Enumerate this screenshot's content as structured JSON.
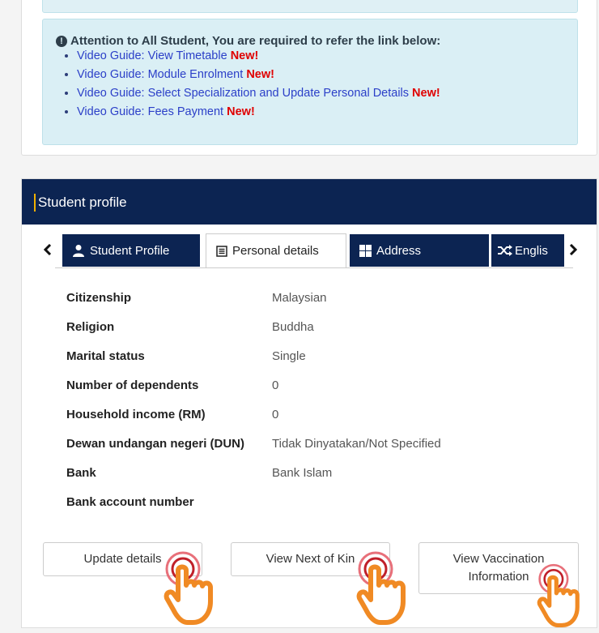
{
  "alert": {
    "heading": "Attention to All Student, You are required to refer the link below:",
    "items": [
      {
        "text": "Video Guide: View Timetable",
        "badge": "New!"
      },
      {
        "text": "Video Guide: Module Enrolment",
        "badge": "New!"
      },
      {
        "text": "Video Guide: Select Specialization and Update Personal Details",
        "badge": "New!"
      },
      {
        "text": "Video Guide: Fees Payment",
        "badge": "New!"
      }
    ]
  },
  "profile": {
    "title": "Student profile",
    "tabs": [
      {
        "label": "Student Profile",
        "icon": "user-icon"
      },
      {
        "label": "Personal details",
        "icon": "list-icon"
      },
      {
        "label": "Address",
        "icon": "grid-icon"
      },
      {
        "label": "Englis",
        "icon": "shuffle-icon"
      }
    ],
    "details": [
      {
        "label": "Citizenship",
        "value": "Malaysian"
      },
      {
        "label": "Religion",
        "value": "Buddha"
      },
      {
        "label": "Marital status",
        "value": "Single"
      },
      {
        "label": "Number of dependents",
        "value": "0"
      },
      {
        "label": "Household income (RM)",
        "value": "0"
      },
      {
        "label": "Dewan undangan negeri (DUN)",
        "value": "Tidak Dinyatakan/Not Specified"
      },
      {
        "label": "Bank",
        "value": "Bank Islam"
      },
      {
        "label": "Bank account number",
        "value": ""
      }
    ],
    "buttons": {
      "update": "Update details",
      "next_of_kin": "View Next of Kin",
      "vaccination_line1": "View Vaccination",
      "vaccination_line2": "Information"
    }
  },
  "colors": {
    "header_bg": "#0c2452",
    "accent_bar": "#f0b000",
    "alert_bg": "#daeff5",
    "new_badge": "#e00000",
    "hand_pointer": "#f08a24"
  }
}
